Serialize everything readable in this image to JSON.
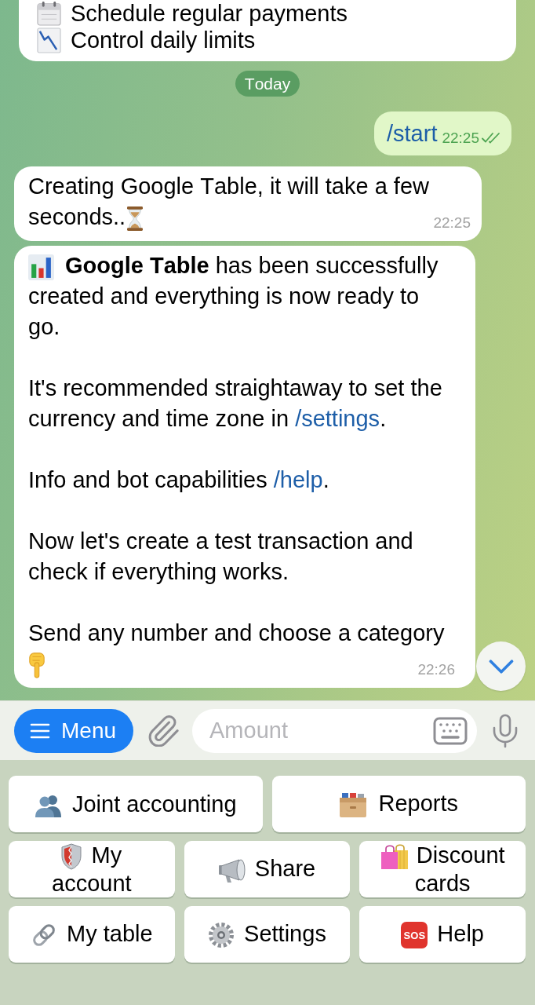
{
  "chat": {
    "messages": [
      {
        "kind": "feature_list",
        "items": [
          "Schedule regular payments",
          "Control daily limits"
        ]
      },
      {
        "kind": "date",
        "text": "Today"
      },
      {
        "kind": "outgoing",
        "text": "/start",
        "time": "22:25",
        "read": true
      },
      {
        "kind": "incoming",
        "paragraphs": [
          {
            "text": "Creating Google Table, it will take a few seconds.."
          }
        ],
        "time": "22:25"
      },
      {
        "kind": "incoming",
        "paragraphs": [
          {
            "text": "**Google Table** has been successfully created and everything is now ready to go."
          },
          {
            "text": "It's recommended straightaway to set the currency and time zone in ",
            "link": "/settings",
            "after": "."
          },
          {
            "text": "Info and bot capabilities ",
            "link": "/help",
            "after": "."
          },
          {
            "text": "Now let's create a test transaction and check if everything works."
          },
          {
            "text": "Send any number and choose a category"
          }
        ],
        "time": "22:26"
      }
    ]
  },
  "composer": {
    "menu_label": "Menu",
    "input": {
      "placeholder": "Amount"
    }
  },
  "keyboard": {
    "rows": [
      [
        {
          "label": "Joint accounting"
        },
        {
          "label": "Reports"
        }
      ],
      [
        {
          "label": "My account"
        },
        {
          "label": "Share"
        },
        {
          "label": "Discount cards"
        }
      ],
      [
        {
          "label": "My table"
        },
        {
          "label": "Settings"
        },
        {
          "label": "Help",
          "badge": "SOS"
        }
      ]
    ]
  }
}
